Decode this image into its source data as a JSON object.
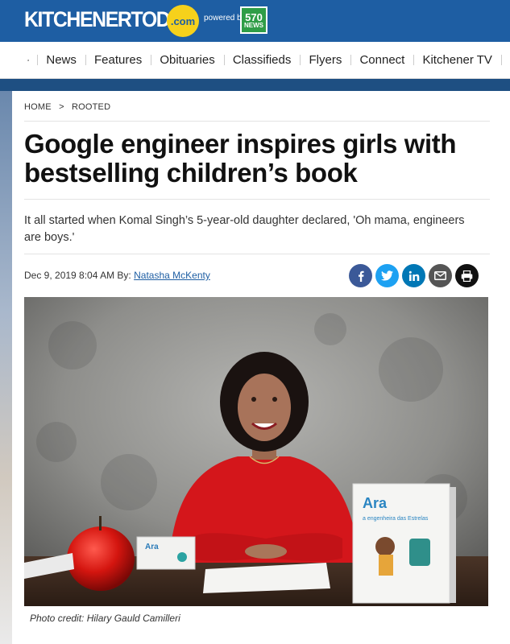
{
  "header": {
    "logo_text": "KITCHENERTODAY",
    "logo_suffix": ".com",
    "powered_by": "powered by",
    "partner_top": "570",
    "partner_bottom": "NEWS"
  },
  "nav": {
    "home_icon": "home-icon",
    "items": [
      "News",
      "Features",
      "Obituaries",
      "Classifieds",
      "Flyers",
      "Connect",
      "Kitchener TV"
    ]
  },
  "breadcrumb": [
    "HOME",
    ">",
    "ROOTED"
  ],
  "article": {
    "title": "Google engineer inspires girls with bestselling children’s book",
    "summary": "It all started when Komal Singh’s 5-year-old daughter declared, 'Oh mama, engineers are boys.'",
    "date": "Dec 9, 2019 8:04 AM",
    "by_label": "By:",
    "author": "Natasha McKenty",
    "photo_credit": "Photo credit: Hilary Gauld Camilleri",
    "photo_book_title": "Ara",
    "photo_book_subtitle": "a engenheira das Estrelas"
  },
  "share": [
    {
      "icon": "facebook-icon",
      "color": "#3b5998"
    },
    {
      "icon": "twitter-icon",
      "color": "#1da1f2"
    },
    {
      "icon": "linkedin-icon",
      "color": "#0077b5"
    },
    {
      "icon": "email-icon",
      "color": "#555555"
    },
    {
      "icon": "print-icon",
      "color": "#111111"
    }
  ],
  "colors": {
    "brand_blue": "#1e5ea3",
    "logo_yellow": "#f6d11b",
    "partner_green": "#2f9d47"
  }
}
